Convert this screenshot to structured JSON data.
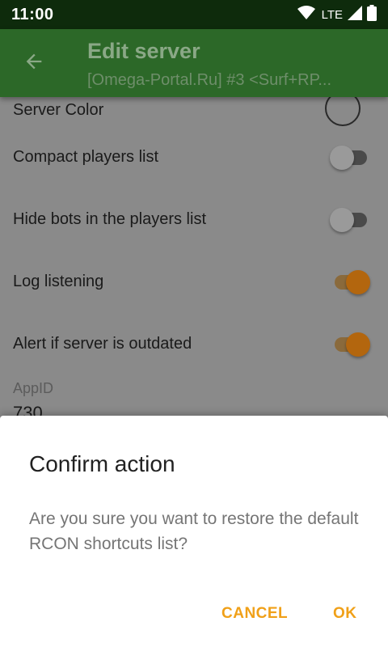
{
  "status_bar": {
    "time": "11:00",
    "network": "LTE",
    "icons": [
      "wifi-icon",
      "signal-icon",
      "battery-icon"
    ]
  },
  "app_bar": {
    "title": "Edit server",
    "subtitle": "[Omega-Portal.Ru] #3 <Surf+RP...",
    "back_icon": "arrow-back-icon"
  },
  "settings": {
    "server_color_label": "Server Color",
    "rows": [
      {
        "label": "Compact players list",
        "enabled": false
      },
      {
        "label": "Hide bots in the players list",
        "enabled": false
      },
      {
        "label": "Log listening",
        "enabled": true
      },
      {
        "label": "Alert if server is outdated",
        "enabled": true
      }
    ],
    "appid_label": "AppID",
    "appid_value": "730"
  },
  "dialog": {
    "title": "Confirm action",
    "message": "Are you sure you want to restore the default RCON shortcuts list?",
    "cancel_label": "CANCEL",
    "ok_label": "OK"
  },
  "colors": {
    "status_bar": "#0e2b0c",
    "app_bar": "#2c6828",
    "accent": "#f0a018",
    "toggle_on": "#b3660e",
    "scrim_content": "#8a8a8a"
  }
}
